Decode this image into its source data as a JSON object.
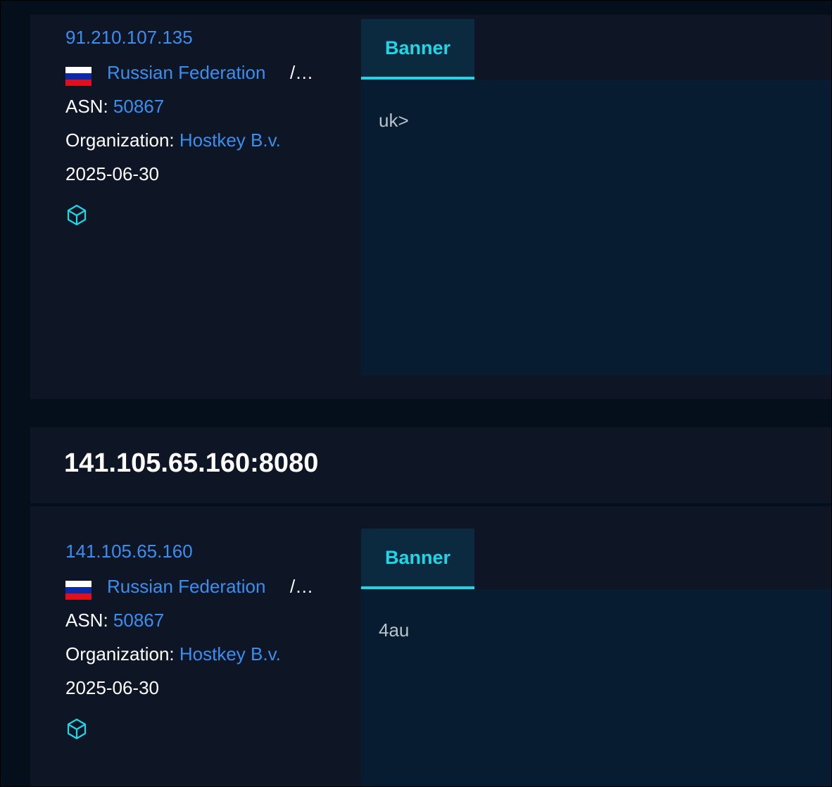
{
  "results": [
    {
      "ip": "91.210.107.135",
      "country": "Russian Federation",
      "country_suffix": "/…",
      "asn_label": "ASN:",
      "asn": "50867",
      "org_label": "Organization:",
      "org": "Hostkey B.v.",
      "date": "2025-06-30",
      "tab_label": "Banner",
      "banner": "uk>"
    },
    {
      "title": "141.105.65.160:8080",
      "ip": "141.105.65.160",
      "country": "Russian Federation",
      "country_suffix": "/…",
      "asn_label": "ASN:",
      "asn": "50867",
      "org_label": "Organization:",
      "org": "Hostkey B.v.",
      "date": "2025-06-30",
      "tab_label": "Banner",
      "banner": "4au"
    }
  ],
  "colors": {
    "link": "#3b8ef0",
    "accent": "#1fd6e6",
    "card": "#0e1525",
    "panel": "#071c30"
  },
  "icons": {
    "flag": "russia-flag-icon",
    "cube": "cube-icon"
  }
}
